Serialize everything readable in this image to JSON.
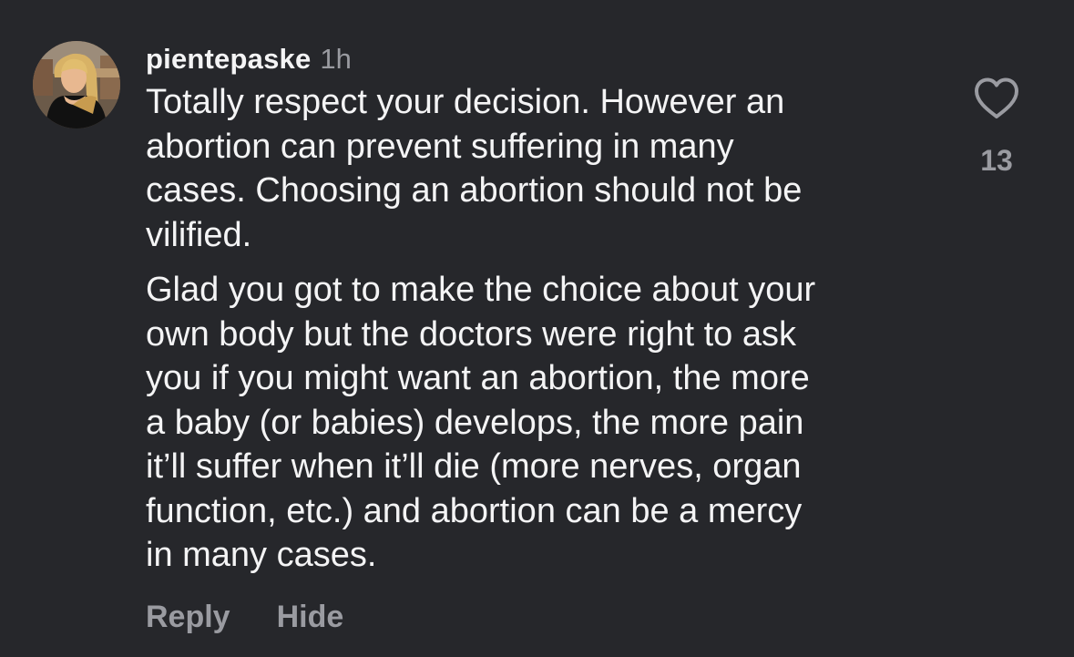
{
  "comment": {
    "username": "pientepaske",
    "time": "1h",
    "avatar_icon": "user-photo",
    "paragraphs": [
      [
        "Totally respect your decision. However an",
        "abortion can prevent suffering in many",
        "cases. Choosing an abortion should not be",
        "vilified."
      ],
      [
        "Glad you got to make the choice about your",
        "own body but the doctors were right to ask",
        "you if you might want an abortion, the more",
        "a baby (or babies) develops, the more pain",
        "it’ll suffer when it’ll die (more nerves, organ",
        "function, etc.) and abortion can be a mercy",
        "in many cases."
      ]
    ],
    "likes": "13",
    "like_icon": "heart-outline-icon",
    "actions": {
      "reply": "Reply",
      "hide": "Hide"
    }
  },
  "colors": {
    "background": "#26272b",
    "text": "#f4f4f5",
    "muted": "#9a9ba1"
  }
}
